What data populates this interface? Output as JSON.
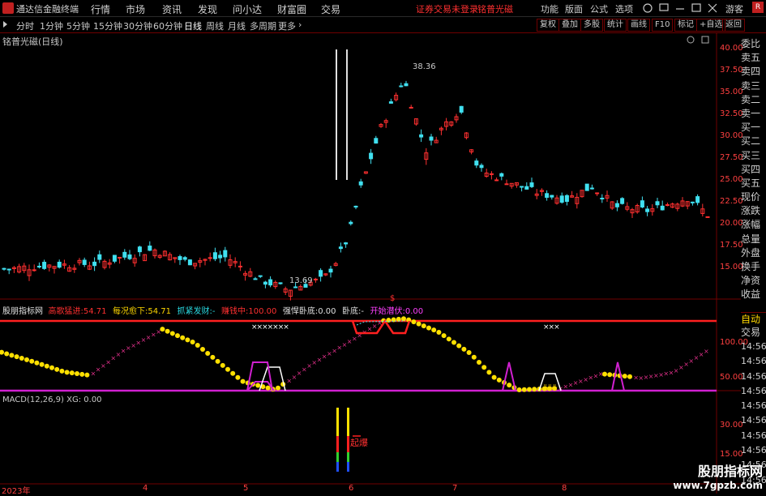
{
  "menubar": {
    "app_title": "通达信金融终端",
    "items": [
      "行情",
      "市场",
      "资讯",
      "发现",
      "问小达",
      "财富圈",
      "交易"
    ],
    "login_warning": "证券交易未登录",
    "stock_link": "铭普光磁",
    "right_items": [
      "功能",
      "版面",
      "公式",
      "选项"
    ],
    "guest": "游客"
  },
  "periods": {
    "items": [
      "分时",
      "1分钟",
      "5分钟",
      "15分钟",
      "30分钟",
      "60分钟",
      "日线",
      "周线",
      "月线",
      "多周期",
      "更多"
    ],
    "active": "日线",
    "tools": [
      "复权",
      "叠加",
      "多股",
      "统计",
      "画线",
      "F10",
      "标记",
      "+自选",
      "返回"
    ]
  },
  "stock": {
    "name": "铭普光磁(日线)",
    "high_label": "38.36",
    "low_label": "13.69"
  },
  "main_axis": {
    "ticks": [
      "40.00",
      "37.50",
      "35.00",
      "32.50",
      "30.00",
      "27.50",
      "25.00",
      "22.50",
      "20.00",
      "17.50",
      "15.00"
    ]
  },
  "right_column": {
    "items": [
      "委比",
      "卖五",
      "卖四",
      "卖三",
      "卖二",
      "卖一",
      "买一",
      "买二",
      "买三",
      "买四",
      "买五",
      "现价",
      "涨跌",
      "涨幅",
      "总量",
      "外盘",
      "换手",
      "净资",
      "收益"
    ],
    "tabs": [
      "自动",
      "交易"
    ],
    "times": [
      "14:56",
      "14:56",
      "14:56",
      "14:56",
      "14:56",
      "14:56",
      "14:56",
      "14:56",
      "14:56",
      "14:56"
    ]
  },
  "indicator": {
    "name": "股朋指标网",
    "fields": [
      {
        "label": "高歌猛进:",
        "value": "54.71"
      },
      {
        "label": "每况愈下:",
        "value": "54.71"
      },
      {
        "label": "抓紧发财:",
        "value": "-"
      },
      {
        "label": "赚钱中:",
        "value": "100.00"
      },
      {
        "label": "强悍卧底:",
        "value": "0.00"
      },
      {
        "label": "卧底:",
        "value": "-"
      },
      {
        "label": "开始潜伏:",
        "value": "0.00"
      }
    ],
    "axis": [
      "100.00",
      "50.00"
    ],
    "marks": [
      "×××××××",
      "×××",
      "$"
    ],
    "icon_text": "ëëë"
  },
  "macd": {
    "label": "MACD(12,26,9) XG: 0.00",
    "axis": [
      "30.00",
      "15.00"
    ],
    "signal_text": "起爆"
  },
  "timeaxis": {
    "labels": [
      "2023年",
      "4",
      "5",
      "6",
      "7",
      "8"
    ]
  },
  "watermark": {
    "line1": "股朋指标网",
    "line2": "www.7gpzb.com"
  }
}
